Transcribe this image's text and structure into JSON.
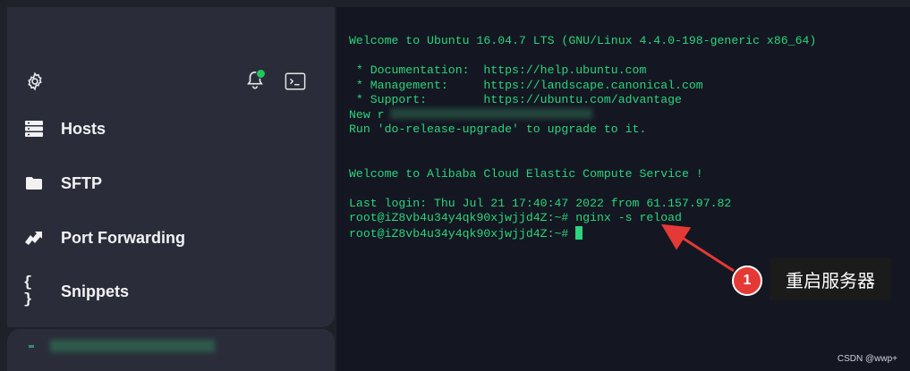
{
  "sidebar": {
    "items": [
      {
        "label": "Hosts",
        "icon": "server-icon"
      },
      {
        "label": "SFTP",
        "icon": "folder-icon"
      },
      {
        "label": "Port Forwarding",
        "icon": "arrow-forward-icon"
      },
      {
        "label": "Snippets",
        "icon": "braces-icon"
      }
    ],
    "snippets_glyph": "{ }",
    "toolbar_icons": [
      "gear-icon",
      "bell-icon",
      "terminal-icon"
    ],
    "notification_color": "#22c55e"
  },
  "terminal": {
    "text_color": "#2bd47d",
    "lines": [
      "Welcome to Ubuntu 16.04.7 LTS (GNU/Linux 4.4.0-198-generic x86_64)",
      "",
      " * Documentation:  https://help.ubuntu.com",
      " * Management:     https://landscape.canonical.com",
      " * Support:        https://ubuntu.com/advantage",
      "New r",
      "Run 'do-release-upgrade' to upgrade to it.",
      "",
      "",
      "Welcome to Alibaba Cloud Elastic Compute Service !",
      "",
      "Last login: Thu Jul 21 17:40:47 2022 from 61.157.97.82",
      "root@iZ8vb4u34y4qk90xjwjjd4Z:~# nginx -s reload",
      "root@iZ8vb4u34y4qk90xjwjjd4Z:~# "
    ]
  },
  "annotation": {
    "number": "1",
    "label": "重启服务器",
    "color": "#e53935"
  },
  "watermark": "CSDN @wwp+"
}
